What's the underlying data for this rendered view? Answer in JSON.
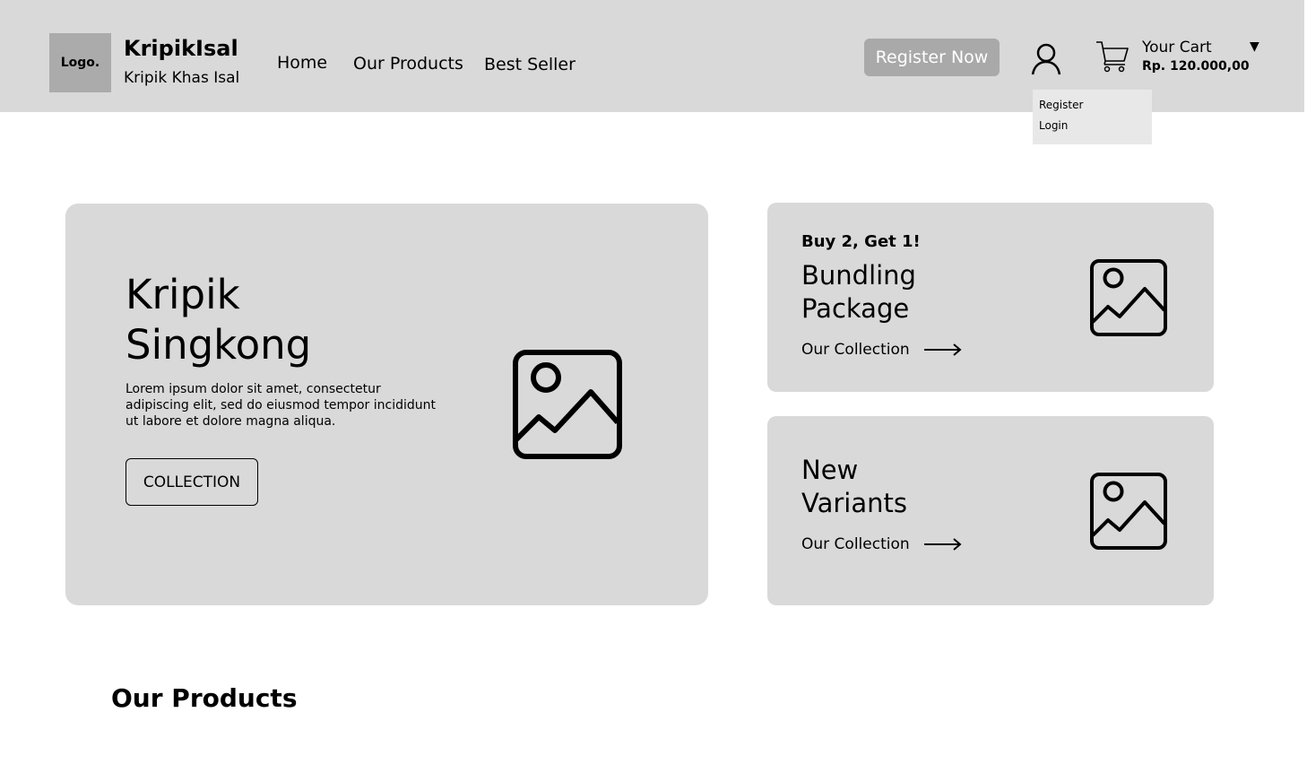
{
  "header": {
    "logo_text": "Logo.",
    "brand_name": "KripikIsal",
    "brand_tagline": "Kripik Khas Isal",
    "nav": [
      {
        "label": "Home"
      },
      {
        "label": "Our Products"
      },
      {
        "label": "Best Seller"
      }
    ],
    "register_button": "Register Now",
    "cart_label": "Your Cart",
    "cart_total": "Rp. 120.000,00",
    "cart_caret": "▼"
  },
  "user_dropdown": {
    "items": [
      {
        "label": "Register"
      },
      {
        "label": "Login"
      }
    ]
  },
  "hero": {
    "title_line1": "Kripik",
    "title_line2": "Singkong",
    "description": "Lorem ipsum dolor sit amet, consectetur adipiscing elit, sed do eiusmod  tempor incididunt ut labore et dolore magna aliqua.",
    "button_label": "COLLECTION"
  },
  "promo_cards": [
    {
      "tag": "Buy 2, Get 1!",
      "title_line1": "Bundling",
      "title_line2": "Package",
      "link_label": "Our Collection"
    },
    {
      "title_line1": "New",
      "title_line2": "Variants",
      "link_label": "Our Collection"
    }
  ],
  "products_section": {
    "title": "Our Products"
  },
  "colors": {
    "panel": "#d9d9d9",
    "button_gray": "#a9a9a9",
    "dropdown_bg": "#e8e8e8"
  },
  "icons": [
    "logo-placeholder",
    "user-icon",
    "cart-icon",
    "image-placeholder-icon",
    "arrow-right-icon"
  ]
}
